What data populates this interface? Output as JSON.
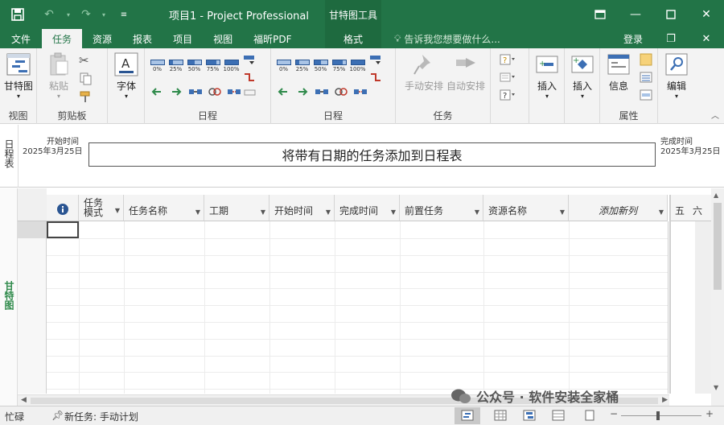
{
  "titlebar": {
    "title": "项目1 - Project Professional",
    "gantt_tools": "甘特图工具",
    "qat": [
      "save-icon",
      "undo-icon",
      "redo-icon",
      "customize-icon"
    ]
  },
  "tabs": [
    {
      "label": "文件"
    },
    {
      "label": "任务"
    },
    {
      "label": "资源"
    },
    {
      "label": "报表"
    },
    {
      "label": "项目"
    },
    {
      "label": "视图"
    },
    {
      "label": "福昕PDF"
    }
  ],
  "format_tab": "格式",
  "tell_me": "告诉我您想要做什么...",
  "login": "登录",
  "ribbon": {
    "view": {
      "button": "甘特图",
      "label": "视图"
    },
    "clipboard": {
      "paste": "粘贴",
      "label": "剪贴板"
    },
    "font": {
      "button": "字体"
    },
    "schedule1": {
      "pcts": [
        "0%",
        "25%",
        "50%",
        "75%",
        "100%"
      ],
      "label": "日程"
    },
    "schedule2": {
      "pcts": [
        "0%",
        "25%",
        "50%",
        "75%",
        "100%"
      ],
      "label": "日程"
    },
    "tasks": {
      "manual": "手动安排",
      "auto": "自动安排",
      "label": "任务"
    },
    "insert1": "插入",
    "insert2": "插入",
    "info": "信息",
    "properties_label": "属性",
    "edit": "编辑"
  },
  "timeline": {
    "side_label": "日程表",
    "start_label": "开始时间",
    "start_date": "2025年3月25日",
    "end_label": "完成时间",
    "end_date": "2025年3月25日",
    "placeholder": "将带有日期的任务添加到日程表"
  },
  "grid": {
    "side_label": "甘特图",
    "columns": [
      {
        "label": "任务\n模式"
      },
      {
        "label": "任务名称"
      },
      {
        "label": "工期"
      },
      {
        "label": "开始时间"
      },
      {
        "label": "完成时间"
      },
      {
        "label": "前置任务"
      },
      {
        "label": "资源名称"
      },
      {
        "label": "添加新列"
      }
    ],
    "chart_days": [
      "五",
      "六"
    ]
  },
  "status": {
    "ready": "忙碌",
    "new_tasks": "新任务: 手动计划"
  },
  "watermark": "公众号 · 软件安装全家桶"
}
